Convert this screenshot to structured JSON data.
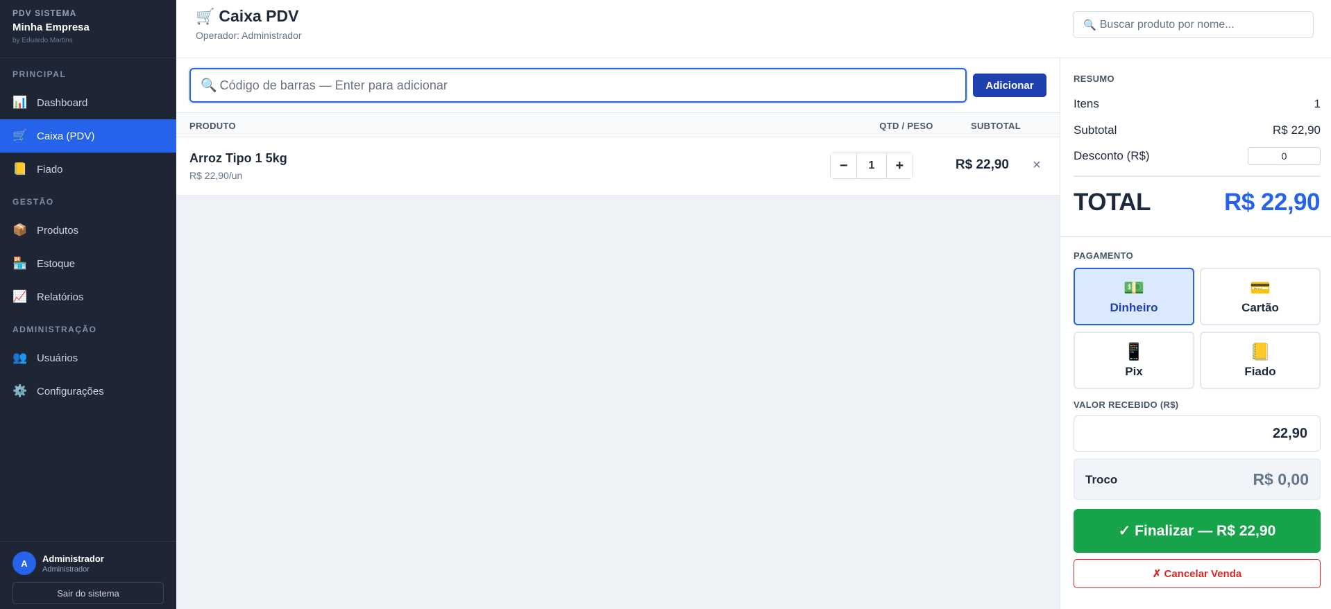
{
  "brand": {
    "system": "PDV SISTEMA",
    "company": "Minha Empresa",
    "by": "by Eduardo Martins"
  },
  "sidebar": {
    "sections": [
      {
        "title": "PRINCIPAL",
        "items": [
          {
            "label": "Dashboard",
            "icon": "bar-chart-icon",
            "glyph": "📊"
          },
          {
            "label": "Caixa (PDV)",
            "icon": "cart-icon",
            "glyph": "🛒",
            "active": true
          },
          {
            "label": "Fiado",
            "icon": "ledger-icon",
            "glyph": "📒"
          }
        ]
      },
      {
        "title": "GESTÃO",
        "items": [
          {
            "label": "Produtos",
            "icon": "package-icon",
            "glyph": "📦"
          },
          {
            "label": "Estoque",
            "icon": "store-icon",
            "glyph": "🏪"
          },
          {
            "label": "Relatórios",
            "icon": "chart-up-icon",
            "glyph": "📈"
          }
        ]
      },
      {
        "title": "ADMINISTRAÇÃO",
        "items": [
          {
            "label": "Usuários",
            "icon": "users-icon",
            "glyph": "👥"
          },
          {
            "label": "Configurações",
            "icon": "gear-icon",
            "glyph": "⚙️"
          }
        ]
      }
    ]
  },
  "user": {
    "initial": "A",
    "name": "Administrador",
    "role": "Administrador",
    "logout_label": "Sair do sistema"
  },
  "header": {
    "title": "Caixa PDV",
    "title_icon": "🛒",
    "operator": "Operador: Administrador",
    "search_icon": "🔍",
    "search_placeholder": "Buscar produto por nome..."
  },
  "scan": {
    "icon": "🔍",
    "placeholder": "Código de barras — Enter para adicionar",
    "add_label": "Adicionar"
  },
  "table": {
    "columns": {
      "product": "PRODUTO",
      "qty": "QTD / PESO",
      "subtotal": "SUBTOTAL"
    },
    "rows": [
      {
        "name": "Arroz Tipo 1 5kg",
        "unit_price": "R$ 22,90/un",
        "qty": "1",
        "subtotal": "R$ 22,90",
        "minus": "−",
        "plus": "+",
        "remove": "×"
      }
    ]
  },
  "summary": {
    "title": "RESUMO",
    "items_label": "Itens",
    "items_value": "1",
    "subtotal_label": "Subtotal",
    "subtotal_value": "R$ 22,90",
    "discount_label": "Desconto (R$)",
    "discount_value": "0",
    "total_label": "TOTAL",
    "total_value": "R$ 22,90"
  },
  "payment": {
    "title": "PAGAMENTO",
    "methods": [
      {
        "label": "Dinheiro",
        "glyph": "💵",
        "icon": "cash-icon",
        "active": true
      },
      {
        "label": "Cartão",
        "glyph": "💳",
        "icon": "card-icon"
      },
      {
        "label": "Pix",
        "glyph": "📱",
        "icon": "phone-icon"
      },
      {
        "label": "Fiado",
        "glyph": "📒",
        "icon": "ledger-icon"
      }
    ],
    "received_label": "VALOR RECEBIDO (R$)",
    "received_value": "22,90",
    "change_label": "Troco",
    "change_value": "R$ 0,00",
    "finish_label": "✓ Finalizar — R$ 22,90",
    "cancel_label": "✗ Cancelar Venda"
  },
  "colors": {
    "accent": "#2563eb",
    "sidebar_bg": "#1e2535",
    "success": "#16a34a",
    "danger": "#dc2626"
  }
}
